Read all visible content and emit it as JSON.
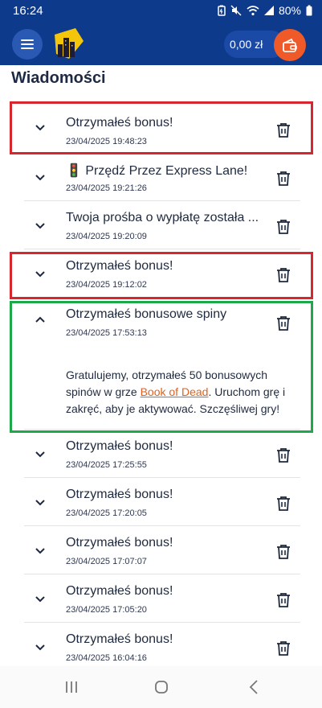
{
  "status_bar": {
    "time": "16:24",
    "battery": "80%",
    "icons": [
      "battery-saver-icon",
      "mute-icon",
      "wifi-icon",
      "signal-icon",
      "battery-icon"
    ]
  },
  "header": {
    "menu_icon": "hamburger-icon",
    "logo": "city-logo",
    "balance": "0,00 zł",
    "cash_icon": "wallet-icon",
    "colors": {
      "bar": "#0e3a8c",
      "accent": "#ef5a28"
    }
  },
  "page": {
    "title": "Wiadomości"
  },
  "messages": [
    {
      "title": "Otrzymałeś bonus!",
      "date": "23/04/2025 19:48:23",
      "expanded": false
    },
    {
      "title": "🚦 Przędź Przez Express Lane!",
      "date": "23/04/2025 19:21:26",
      "expanded": false
    },
    {
      "title": "Twoja prośba o wypłatę została ...",
      "date": "23/04/2025 19:20:09",
      "expanded": false
    },
    {
      "title": "Otrzymałeś bonus!",
      "date": "23/04/2025 19:12:02",
      "expanded": false
    },
    {
      "title": "Otrzymałeś bonusowe spiny",
      "date": "23/04/2025 17:53:13",
      "expanded": true,
      "body_before": "Gratulujemy, otrzymałeś 50 bonusowych spinów w grze ",
      "body_link": "Book of Dead",
      "body_after": ". Uruchom grę i zakręć, aby je aktywować. Szczęśliwej gry!"
    },
    {
      "title": "Otrzymałeś bonus!",
      "date": "23/04/2025 17:25:55",
      "expanded": false
    },
    {
      "title": "Otrzymałeś bonus!",
      "date": "23/04/2025 17:20:05",
      "expanded": false
    },
    {
      "title": "Otrzymałeś bonus!",
      "date": "23/04/2025 17:07:07",
      "expanded": false
    },
    {
      "title": "Otrzymałeś bonus!",
      "date": "23/04/2025 17:05:20",
      "expanded": false
    },
    {
      "title": "Otrzymałeś bonus!",
      "date": "23/04/2025 16:04:16",
      "expanded": false
    }
  ],
  "highlights": {
    "red": "#d8262f",
    "green": "#1fa84a"
  },
  "nav_bar": {
    "icons": [
      "recent-apps-icon",
      "home-icon",
      "back-icon"
    ]
  }
}
